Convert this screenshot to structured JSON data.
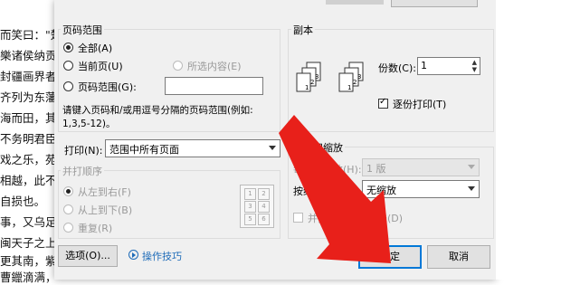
{
  "background": {
    "lines": [
      "而笑曰：\"楚",
      "樂诸侯纳贡",
      "封疆画界者",
      "齐列为东藩",
      "海而田，其",
      "不务明君臣",
      "戏之乐，苑",
      "相越，此不",
      "自损也。",
      "事，又乌足",
      "闽天子之上",
      "更其南，紫",
      "曹鑞滴满，"
    ]
  },
  "dialog": {
    "page_range": {
      "title": "页码范围",
      "all_label": "全部(A)",
      "current_label": "当前页(U)",
      "selection_label": "所选内容(E)",
      "pages_label": "页码范围(G):",
      "pages_value": "",
      "hint_line1": "请键入页码和/或用逗号分隔的页码范围(例如:",
      "hint_line2": "1,3,5-12)。"
    },
    "print_what": {
      "label": "打印(N):",
      "value": "范围中所有页面"
    },
    "collate_order": {
      "title": "并打顺序",
      "left_to_right": "从左到右(F)",
      "top_to_bottom": "从上到下(B)",
      "repeat": "重复(R)",
      "grid": [
        "1",
        "2",
        "3",
        "4",
        "5",
        "6"
      ]
    },
    "copies": {
      "title": "副本",
      "count_label": "份数(C):",
      "count_value": "1",
      "collate_label": "逐份打印(T)",
      "collate_checked": true
    },
    "scaling": {
      "title": "并打和缩放",
      "pages_per_sheet_label": "每页的版数(H):",
      "pages_per_sheet_value": "1 版",
      "scale_label": "按纸型缩放(Z):",
      "scale_value": "无缩放",
      "borders_label": "并打时绘制分隔线(D)"
    },
    "buttons": {
      "options": "选项(O)...",
      "tips": "操作技巧",
      "ok": "确定",
      "cancel": "取消"
    }
  },
  "colors": {
    "arrow": "#e8201a",
    "ok_border": "#0078d7",
    "tips_link": "#1e6bb8"
  }
}
